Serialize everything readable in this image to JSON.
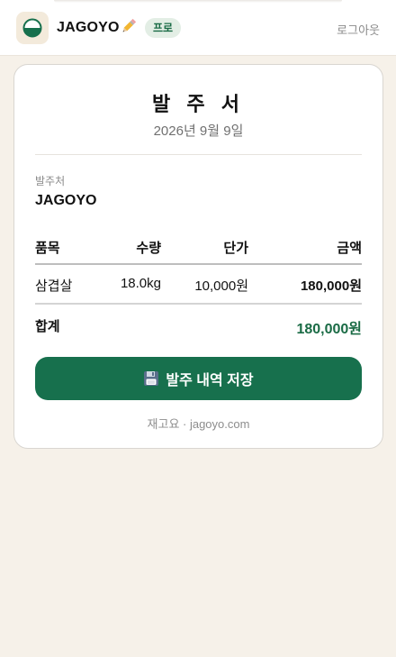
{
  "header": {
    "app_name": "JAGOYO",
    "badge": "프로",
    "logout_label": "로그아웃"
  },
  "order": {
    "title": "발 주 서",
    "date": "2026년 9월 9일",
    "recipient_label": "발주처",
    "recipient": "JAGOYO",
    "table": {
      "headers": {
        "item": "품목",
        "qty": "수량",
        "unit_price": "단가",
        "amount": "금액"
      },
      "rows": [
        {
          "item": "삼겹살",
          "qty": "18.0kg",
          "unit_price": "10,000원",
          "amount": "180,000원"
        }
      ],
      "total_label": "합계",
      "total_value": "180,000원"
    },
    "save_button": "발주 내역 저장",
    "footer": "재고요 · jagoyo.com"
  },
  "colors": {
    "brand_green": "#17704d",
    "background": "#f6f1e9",
    "badge_bg": "#e3eee5"
  },
  "icons": [
    "logo-icon",
    "pencil-icon",
    "floppy-disk-icon"
  ]
}
